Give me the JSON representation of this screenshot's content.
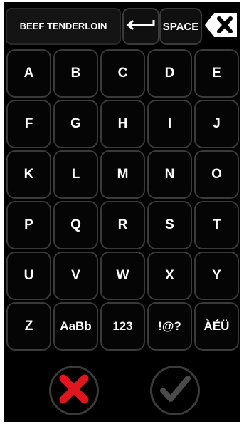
{
  "entry": {
    "text": "BEEF TENDERLOIN"
  },
  "top_keys": {
    "enter_icon": "enter-arrow-icon",
    "space_label": "SPACE",
    "backspace_icon": "backspace-icon"
  },
  "keys": [
    "A",
    "B",
    "C",
    "D",
    "E",
    "F",
    "G",
    "H",
    "I",
    "J",
    "K",
    "L",
    "M",
    "N",
    "O",
    "P",
    "Q",
    "R",
    "S",
    "T",
    "U",
    "V",
    "W",
    "X",
    "Y",
    "Z",
    "AaBb",
    "123",
    "!@?",
    "ÀÉÜ"
  ],
  "actions": {
    "cancel_icon": "x-icon",
    "confirm_icon": "check-icon"
  },
  "colors": {
    "background": "#000000",
    "key_border": "#3a3a3a",
    "cancel_red": "#e0161f",
    "confirm_gray": "#4a4a4a"
  }
}
